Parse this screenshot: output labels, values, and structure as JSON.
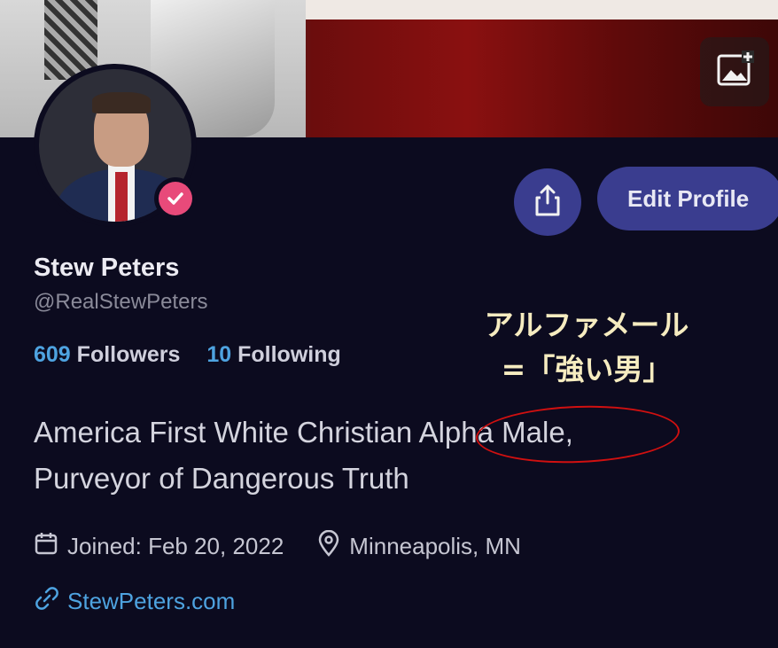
{
  "profile": {
    "display_name": "Stew Peters",
    "handle": "@RealStewPeters",
    "followers_count": "609",
    "followers_label": "Followers",
    "following_count": "10",
    "following_label": "Following",
    "bio_line1": "America First White Christian Alpha Male,",
    "bio_line2": "Purveyor of Dangerous Truth",
    "joined": "Joined: Feb 20, 2022",
    "location": "Minneapolis, MN",
    "website": "StewPeters.com"
  },
  "actions": {
    "edit_profile_label": "Edit Profile"
  },
  "annotation": {
    "line1": "アルファメール",
    "line2": "=「強い男」"
  },
  "icons": {
    "banner_action": "add-image-icon",
    "share": "share-icon",
    "verified": "verified-check-icon",
    "calendar": "calendar-icon",
    "location": "location-pin-icon",
    "website": "link-icon"
  },
  "colors": {
    "background": "#0c0b1f",
    "accent_button": "#3a3d8f",
    "link_blue": "#4ea3e0",
    "verified_pink": "#e84a7a",
    "annotation_red": "#d01010",
    "annotation_text": "#f6ecc0"
  }
}
